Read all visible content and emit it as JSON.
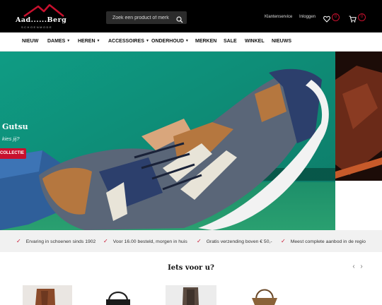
{
  "brand": {
    "name": "Aad......Berg",
    "tagline": "SCHOENMODE"
  },
  "search": {
    "placeholder": "Zoek een product of merk"
  },
  "topbar": {
    "links": [
      "Klantenservice",
      "Inloggen"
    ],
    "wishlist_count": "0",
    "cart_count": "0"
  },
  "nav": {
    "items": [
      "NIEUW",
      "DAMES",
      "HEREN",
      "ACCESSOIRES",
      "ONDERHOUD",
      "MERKEN",
      "SALE",
      "WINKEL",
      "NIEUWS"
    ],
    "dropdown_items": [
      "DAMES",
      "HEREN",
      "ACCESSOIRES",
      "ONDERHOUD"
    ]
  },
  "hero": {
    "title": "Gutsu",
    "subtitle": "kies jij?",
    "cta": "COLLECTIE"
  },
  "usps": [
    "Ervaring in schoenen sinds 1902",
    "Voor 16.00 besteld, morgen in huis",
    "Gratis verzending boven € 50,-",
    "Meest complete aanbod in de regio"
  ],
  "suggestions": {
    "title": "Iets voor u?",
    "prev_icon": "chevron-left-icon",
    "next_icon": "chevron-right-icon",
    "products": [
      "ankle-boot",
      "handbag",
      "boot",
      "shoulder-bag"
    ]
  },
  "colors": {
    "brand_red": "#c8102e",
    "topbar": "#000000",
    "hero_green": "#13907a"
  }
}
